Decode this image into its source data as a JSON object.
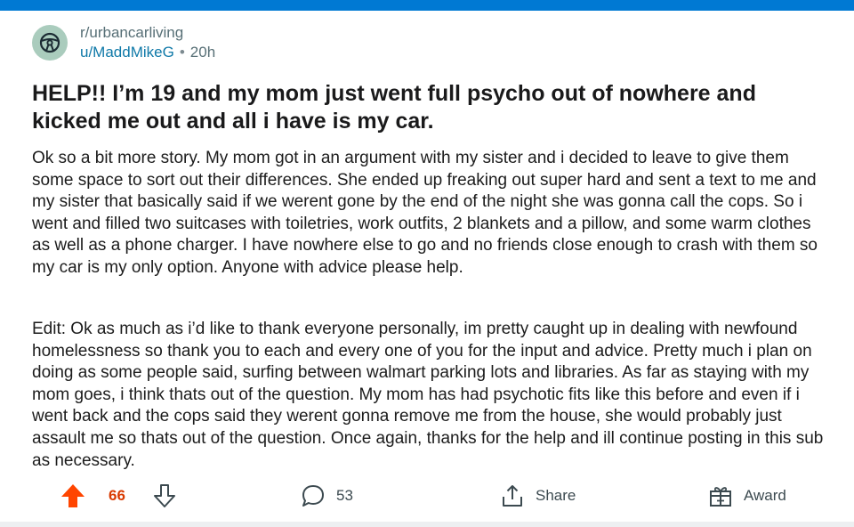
{
  "post": {
    "subreddit": "r/urbancarliving",
    "author": "u/MaddMikeG",
    "separator": "•",
    "time": "20h",
    "title": "HELP!! I’m 19 and my mom just went full psycho out of nowhere and kicked me out and all i have is my car.",
    "paragraphs": [
      "Ok so a bit more story. My mom got in an argument with my sister and i decided to leave to give them some space to sort out their differences. She ended up freaking out super hard and sent a text to me and my sister that basically said if we werent gone by the end of the night she was gonna call the cops. So i went and filled two suitcases with toiletries, work outfits, 2 blankets and a pillow, and some warm clothes as well as a phone charger. I have nowhere else to go and no friends close enough to crash with them so my car is my only option. Anyone with advice please help.",
      "Edit: Ok as much as i’d like to thank everyone personally, im pretty caught up in dealing with newfound homelessness so thank you to each and every one of you for the input and advice. Pretty much i plan on doing as some people said, surfing between walmart parking lots and libraries. As far as staying with my mom goes, i think thats out of the question. My mom has had psychotic fits like this before and even if i went back and the cops said they werent gonna remove me from the house, she would probably just assault me so thats out of the question. Once again, thanks for the help and ill continue posting in this sub as necessary."
    ]
  },
  "actions": {
    "upvotes": "66",
    "comments": "53",
    "share_label": "Share",
    "award_label": "Award"
  },
  "colors": {
    "accent_bar": "#0079d3",
    "upvote_active": "#ff4500",
    "vote_count": "#d93a00",
    "username": "#0f79a8",
    "avatar_bg": "#aaccbd"
  },
  "icons": {
    "avatar": "steering-wheel-icon",
    "upvote": "arrow-up-icon",
    "downvote": "arrow-down-icon",
    "comment": "comment-bubble-icon",
    "share": "share-icon",
    "award": "award-gift-icon"
  }
}
